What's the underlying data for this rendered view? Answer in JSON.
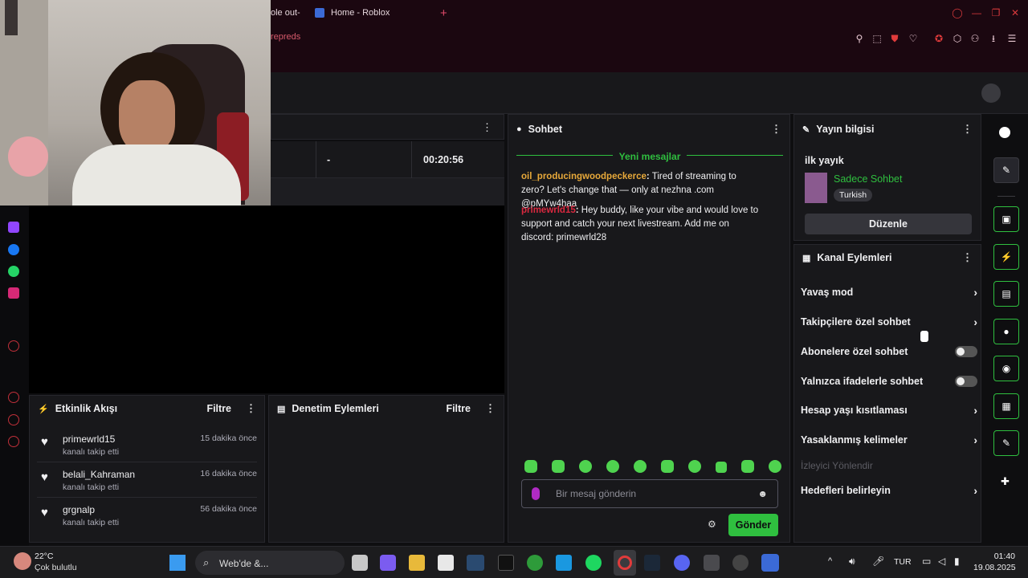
{
  "browser": {
    "tabs": [
      {
        "label": "ole out-"
      },
      {
        "label": "Home - Roblox"
      }
    ],
    "new_tab": "+",
    "url_fragment": "repreds"
  },
  "stats": {
    "dash": "-",
    "uptime": "00:20:56"
  },
  "activity_feed": {
    "title": "Etkinlik Akışı",
    "filter": "Filtre",
    "items": [
      {
        "user": "primewrld15",
        "action": "kanalı takip etti",
        "time": "15 dakika önce"
      },
      {
        "user": "belali_Kahraman",
        "action": "kanalı takip etti",
        "time": "16 dakika önce"
      },
      {
        "user": "grgnalp",
        "action": "kanalı takip etti",
        "time": "56 dakika önce"
      }
    ]
  },
  "mod_actions": {
    "title": "Denetim Eylemleri",
    "filter": "Filtre"
  },
  "chat": {
    "title": "Sohbet",
    "divider": "Yeni mesajlar",
    "messages": [
      {
        "user": "oil_producingwoodpeckerce",
        "user_color": "#e8a93a",
        "text": " Tired of streaming to zero? Let's change that — only at nezhna .com @pMYw4haa"
      },
      {
        "user": "primewrld15",
        "user_color": "#d9283f",
        "text": " Hey buddy, like your vibe and would love to support and catch your next livestream. Add me on discord: primewrld28"
      }
    ],
    "input_placeholder": "Bir mesaj gönderin",
    "send_label": "Gönder"
  },
  "stream_info": {
    "title": "Yayın bilgisi",
    "stream_title": "ilk yayık",
    "category": "Sadece Sohbet",
    "tag": "Turkish",
    "edit_label": "Düzenle"
  },
  "channel_actions": {
    "title": "Kanal Eylemleri",
    "items": [
      {
        "label": "Yavaş mod",
        "kind": "arrow"
      },
      {
        "label": "Takipçilere özel sohbet",
        "kind": "arrow"
      },
      {
        "label": "Abonelere özel sohbet",
        "kind": "toggle"
      },
      {
        "label": "Yalnızca ifadelerle sohbet",
        "kind": "toggle"
      },
      {
        "label": "Hesap yaşı kısıtlaması",
        "kind": "arrow"
      },
      {
        "label": "Yasaklanmış kelimeler",
        "kind": "arrow"
      }
    ],
    "disabled_item": "İzleyici Yönlendir",
    "last_item": "Hedefleri belirleyin"
  },
  "taskbar": {
    "weather_temp": "22°C",
    "weather_desc": "Çok bulutlu",
    "search_label": "Web'de &...",
    "lang": "TUR",
    "time": "01:40",
    "date": "19.08.2025"
  },
  "colors": {
    "accent_green": "#2fbf3f",
    "brand_red": "#d6393c"
  }
}
